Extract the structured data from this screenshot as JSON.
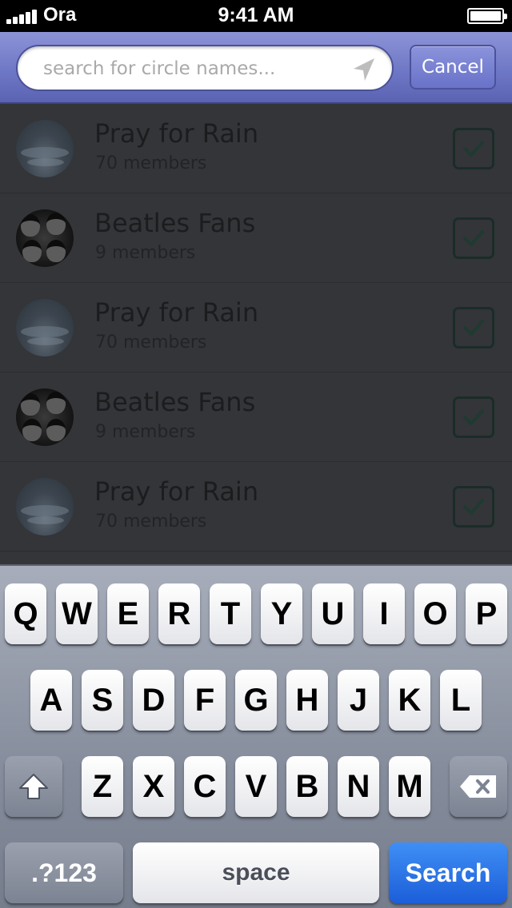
{
  "status_bar": {
    "carrier": "Ora",
    "time": "9:41 AM"
  },
  "search": {
    "placeholder": "search for circle names...",
    "value": "",
    "cancel_label": "Cancel"
  },
  "circles": [
    {
      "title": "Pray for Rain",
      "members": "70 members",
      "avatar": "sky-clouds",
      "checked": true
    },
    {
      "title": "Beatles Fans",
      "members": "9 members",
      "avatar": "beatles-photo",
      "checked": true
    },
    {
      "title": "Pray for Rain",
      "members": "70 members",
      "avatar": "sky-clouds",
      "checked": true
    },
    {
      "title": "Beatles Fans",
      "members": "9 members",
      "avatar": "beatles-photo",
      "checked": true
    },
    {
      "title": "Pray for Rain",
      "members": "70 members",
      "avatar": "sky-clouds",
      "checked": true
    }
  ],
  "keyboard": {
    "row1": [
      "Q",
      "W",
      "E",
      "R",
      "T",
      "Y",
      "U",
      "I",
      "O",
      "P"
    ],
    "row2": [
      "A",
      "S",
      "D",
      "F",
      "G",
      "H",
      "J",
      "K",
      "L"
    ],
    "row3": [
      "Z",
      "X",
      "C",
      "V",
      "B",
      "N",
      "M"
    ],
    "numbers_label": ".?123",
    "space_label": "space",
    "search_label": "Search"
  },
  "colors": {
    "header": "#7a82cf",
    "list_background": "#343538",
    "search_key": "#2a72e8"
  }
}
